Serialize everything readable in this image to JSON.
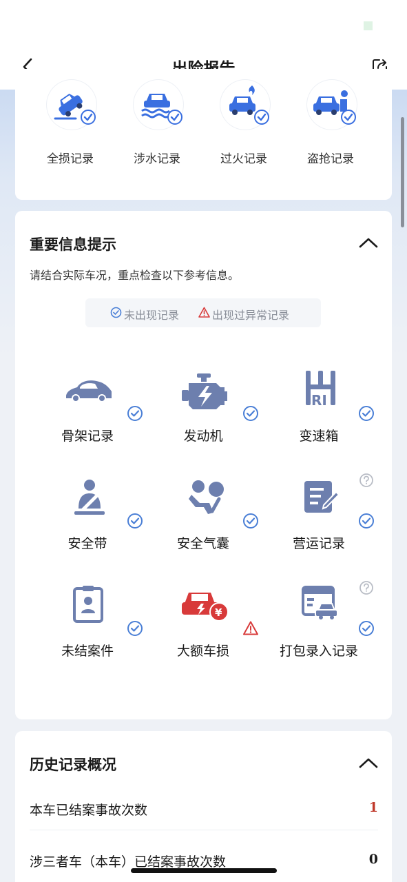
{
  "header": {
    "title": "出险报告",
    "back_icon": "chevron-left-icon",
    "share_icon": "share-external-icon"
  },
  "top_records": [
    {
      "label": "全损记录",
      "icon": "car-total-loss-icon",
      "status": "ok"
    },
    {
      "label": "涉水记录",
      "icon": "car-flood-icon",
      "status": "ok"
    },
    {
      "label": "过火记录",
      "icon": "car-fire-icon",
      "status": "ok"
    },
    {
      "label": "盗抢记录",
      "icon": "car-theft-icon",
      "status": "ok"
    }
  ],
  "important": {
    "title": "重要信息提示",
    "desc": "请结合实际车况，重点检查以下参考信息。",
    "legend_ok": "未出现记录",
    "legend_warn": "出现过异常记录",
    "items": [
      {
        "label": "骨架记录",
        "icon": "car-frame-icon",
        "status": "ok",
        "help": false
      },
      {
        "label": "发动机",
        "icon": "engine-icon",
        "status": "ok",
        "help": false
      },
      {
        "label": "变速箱",
        "icon": "gearbox-icon",
        "status": "ok",
        "help": false
      },
      {
        "label": "安全带",
        "icon": "seatbelt-icon",
        "status": "ok",
        "help": false
      },
      {
        "label": "安全气囊",
        "icon": "airbag-icon",
        "status": "ok",
        "help": false
      },
      {
        "label": "营运记录",
        "icon": "operation-record-icon",
        "status": "ok",
        "help": true
      },
      {
        "label": "未结案件",
        "icon": "pending-case-icon",
        "status": "ok",
        "help": false
      },
      {
        "label": "大额车损",
        "icon": "major-damage-icon",
        "status": "warn",
        "help": false
      },
      {
        "label": "打包录入记录",
        "icon": "bundle-entry-icon",
        "status": "ok",
        "help": true
      }
    ]
  },
  "history": {
    "title": "历史记录概况",
    "rows": [
      {
        "label": "本车已结案事故次数",
        "value": "1",
        "color": "#c0392b"
      },
      {
        "label": "涉三者车（本车）已结案事故次数",
        "value": "0",
        "color": "#1a1a1a"
      }
    ]
  },
  "colors": {
    "primary_icon": "#6d7fae",
    "ok_blue": "#4a7fd6",
    "warn_red": "#d83a3a"
  }
}
